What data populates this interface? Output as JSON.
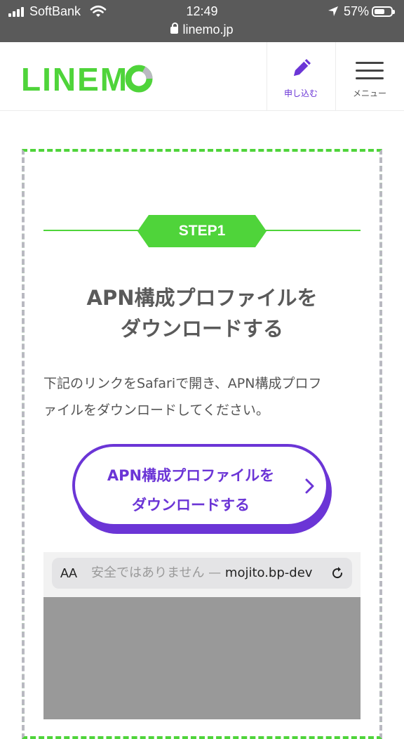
{
  "status_bar": {
    "carrier": "SoftBank",
    "time": "12:49",
    "battery": "57%",
    "url": "linemo.jp"
  },
  "header": {
    "logo": "LINEMO",
    "apply_label": "申し込む",
    "menu_label": "メニュー"
  },
  "step": {
    "badge": "STEP1",
    "title_line1": "APN構成プロファイルを",
    "title_line2": "ダウンロードする",
    "desc_line1": "下記のリンクをSafariで開き、APN構成プロフ",
    "desc_line2": "ァイルをダウンロードしてください。",
    "cta_line1": "APN構成プロファイルを",
    "cta_line2": "ダウンロードする"
  },
  "screenshot": {
    "aa_label": "AA",
    "insecure_text": "安全ではありません — ",
    "domain_text": "mojito.bp-dev"
  },
  "colors": {
    "brand_green": "#4fd43a",
    "accent_purple": "#6b35d6",
    "status_bar": "#5a5a5a"
  }
}
